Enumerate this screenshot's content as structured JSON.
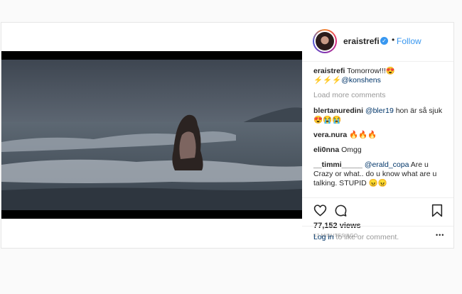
{
  "post": {
    "username": "eraistrefi",
    "follow_label": "Follow",
    "separator": "•",
    "verified_glyph": "✓"
  },
  "caption": {
    "username": "eraistrefi",
    "text": "Tomorrow!!!😍",
    "line2_emoji": "⚡⚡⚡",
    "mention": "@konshens"
  },
  "load_more_label": "Load more comments",
  "comments": [
    {
      "user": "blertanuredini",
      "mention": "@bler19",
      "text": " hon är så sjuk 😍😭😭"
    },
    {
      "user": "vera.nura",
      "mention": "",
      "text": "🔥🔥🔥"
    },
    {
      "user": "eli0nna",
      "mention": "",
      "text": "Omgg"
    },
    {
      "user": "__timmi_____",
      "mention": "@erald_copa",
      "text": " Are u Crazy or what.. do u know what are u talking. STUPID 😠😠"
    }
  ],
  "stats": {
    "views": "77,152 views",
    "time": "57 MINUTES AGO"
  },
  "footer": {
    "login_link": "Log in",
    "login_rest": " to like or comment.",
    "more_glyph": "•••"
  },
  "icons": {
    "like": "heart-icon",
    "comment": "comment-bubble-icon",
    "save": "bookmark-icon",
    "more": "more-options-icon"
  },
  "colors": {
    "link_blue": "#3897f0",
    "mention_blue": "#003569",
    "muted": "#999999"
  }
}
